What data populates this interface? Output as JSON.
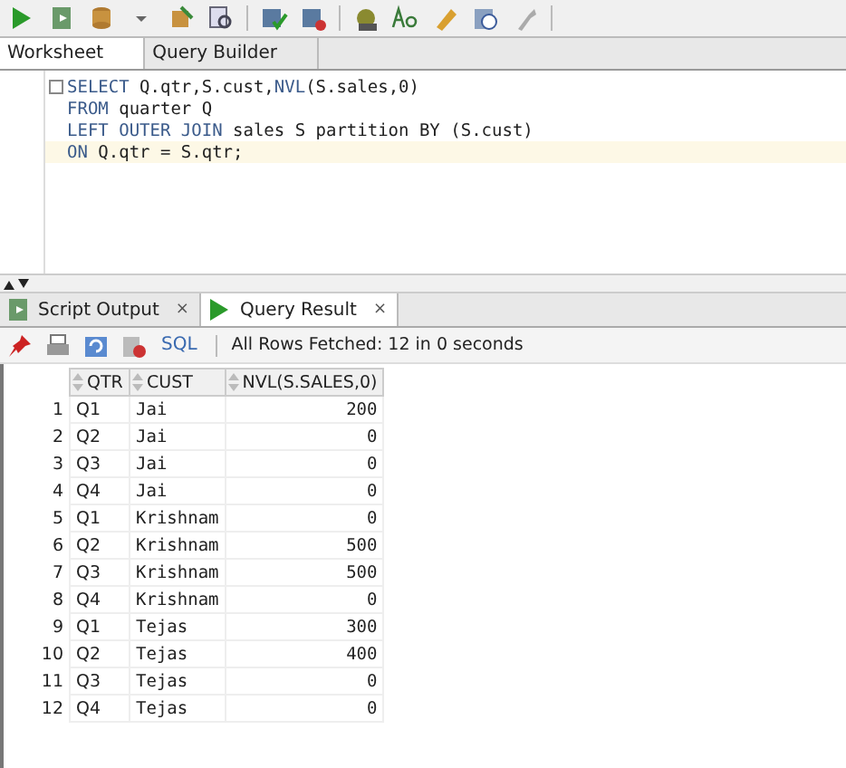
{
  "editor_tabs": [
    {
      "label": "Worksheet",
      "selected": true
    },
    {
      "label": "Query Builder",
      "selected": false
    }
  ],
  "editor": {
    "lines": [
      {
        "current": false,
        "collapsible": true,
        "tokens": [
          {
            "kind": "keyword",
            "text": "SELECT"
          },
          {
            "kind": "plain",
            "text": " Q.qtr,S.cust,"
          },
          {
            "kind": "keyword",
            "text": "NVL"
          },
          {
            "kind": "plain",
            "text": "(S.sales,0)"
          }
        ]
      },
      {
        "current": false,
        "collapsible": false,
        "tokens": [
          {
            "kind": "keyword",
            "text": "FROM"
          },
          {
            "kind": "plain",
            "text": " quarter Q"
          }
        ]
      },
      {
        "current": false,
        "collapsible": false,
        "tokens": [
          {
            "kind": "keyword",
            "text": "LEFT OUTER JOIN"
          },
          {
            "kind": "plain",
            "text": " sales S partition BY (S.cust)"
          }
        ]
      },
      {
        "current": true,
        "collapsible": false,
        "tokens": [
          {
            "kind": "keyword",
            "text": "ON"
          },
          {
            "kind": "plain",
            "text": " Q.qtr = S.qtr;"
          }
        ]
      }
    ]
  },
  "result_tabs": [
    {
      "label": "Script Output",
      "selected": false,
      "kind": "script",
      "close": "×"
    },
    {
      "label": "Query Result",
      "selected": true,
      "kind": "query",
      "close": "×"
    }
  ],
  "result_toolbar": {
    "sql_button": "SQL",
    "status": "All Rows Fetched: 12 in 0 seconds"
  },
  "table": {
    "columns": [
      "QTR",
      "CUST",
      "NVL(S.SALES,0)"
    ],
    "rows": [
      {
        "num": "1",
        "qtr": "Q1",
        "cust": "Jai",
        "nvl": "200"
      },
      {
        "num": "2",
        "qtr": "Q2",
        "cust": "Jai",
        "nvl": "0"
      },
      {
        "num": "3",
        "qtr": "Q3",
        "cust": "Jai",
        "nvl": "0"
      },
      {
        "num": "4",
        "qtr": "Q4",
        "cust": "Jai",
        "nvl": "0"
      },
      {
        "num": "5",
        "qtr": "Q1",
        "cust": "Krishnam",
        "nvl": "0"
      },
      {
        "num": "6",
        "qtr": "Q2",
        "cust": "Krishnam",
        "nvl": "500"
      },
      {
        "num": "7",
        "qtr": "Q3",
        "cust": "Krishnam",
        "nvl": "500"
      },
      {
        "num": "8",
        "qtr": "Q4",
        "cust": "Krishnam",
        "nvl": "0"
      },
      {
        "num": "9",
        "qtr": "Q1",
        "cust": "Tejas",
        "nvl": "300"
      },
      {
        "num": "10",
        "qtr": "Q2",
        "cust": "Tejas",
        "nvl": "400"
      },
      {
        "num": "11",
        "qtr": "Q3",
        "cust": "Tejas",
        "nvl": "0"
      },
      {
        "num": "12",
        "qtr": "Q4",
        "cust": "Tejas",
        "nvl": "0"
      }
    ]
  }
}
